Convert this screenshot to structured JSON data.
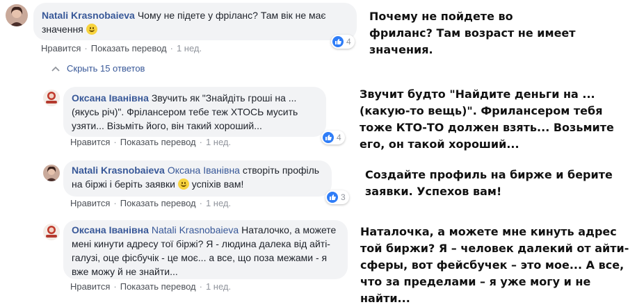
{
  "comments": [
    {
      "author": "Natali Krasnobaieva",
      "text_before": "Чому не підете у фріланс? Там вік не має значення",
      "text_after": "",
      "mention": "",
      "emoji": true,
      "actions": {
        "like": "Нравится",
        "translate": "Показать перевод",
        "time": "1 нед."
      },
      "reactions": "4",
      "translation": "Почему не пойдете во фриланс? Там возраст не имеет значения."
    },
    {
      "author": "Оксана Іванівна",
      "text_before": "Звучить як \"Знайдіть гроші на ... (якусь річ)\". Фрілансером тебе теж ХТОСЬ мусить узяти... Візьміть його, він такий хороший...",
      "text_after": "",
      "mention": "",
      "emoji": false,
      "actions": {
        "like": "Нравится",
        "translate": "Показать перевод",
        "time": "1 нед."
      },
      "reactions": "4",
      "translation": "Звучит будто \"Найдите деньги на ... (какую-то вещь)\". Фрилансером тебя тоже КТО-ТО должен взять... Возьмите его, он такой хороший..."
    },
    {
      "author": "Natali Krasnobaieva",
      "mention": "Оксана Іванівна",
      "text_before": "створіть профіль на біржі і беріть заявки",
      "text_after": "успіхів вам!",
      "emoji": true,
      "actions": {
        "like": "Нравится",
        "translate": "Показать перевод",
        "time": "1 нед."
      },
      "reactions": "3",
      "translation": "Создайте профиль на бирже и берите заявки. Успехов вам!"
    },
    {
      "author": "Оксана Іванівна",
      "mention": "Natali Krasnobaieva",
      "text_before": "Наталочко, а можете мені кинути адресу тої біржі? Я - людина далека від айті-галузі, оце фісбучік - це моє... а все, що поза межами - я вже можу й не знайти...",
      "text_after": "",
      "emoji": false,
      "actions": {
        "like": "Нравится",
        "translate": "Показать перевод",
        "time": "1 нед."
      },
      "reactions": "",
      "translation": "Наталочка, а можете мне кинуть адрес той биржи? Я – человек далекий от айти-сферы, вот фейсбучек – это мое... А все, что за пределами – я уже могу и не найти..."
    }
  ],
  "hide_replies": "Скрыть 15 ответов",
  "icons": {
    "like": "thumbs-up-icon",
    "emoji": "smiley-icon",
    "collapse": "chevron-up-icon"
  },
  "colors": {
    "link": "#385898",
    "bubble": "#f2f3f5",
    "like": "#2f7df7"
  }
}
